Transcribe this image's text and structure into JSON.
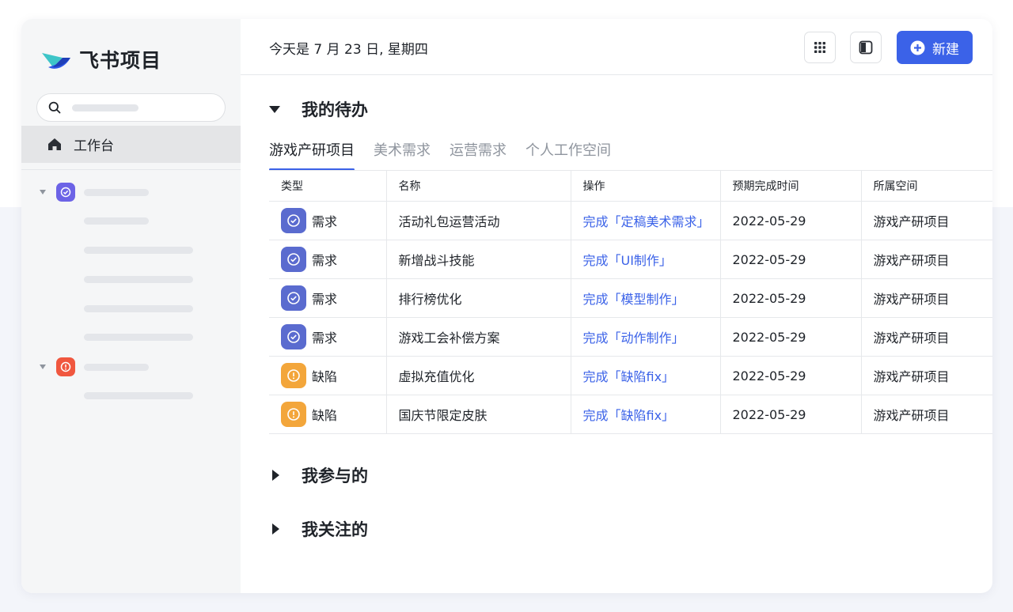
{
  "app": {
    "name": "飞书项目"
  },
  "header": {
    "date_text": "今天是 7 月 23 日, 星期四",
    "new_button_label": "新建"
  },
  "sidebar": {
    "active_item": {
      "label": "工作台",
      "icon": "home-icon"
    },
    "groups": [
      {
        "icon": "check-circle-icon",
        "color": "#6c63e6",
        "skeleton_item_count": 5
      },
      {
        "icon": "alert-circle-icon",
        "color": "#f0573f",
        "skeleton_item_count": 1
      }
    ]
  },
  "sections": {
    "todo": {
      "title": "我的待办",
      "expanded": true
    },
    "participated": {
      "title": "我参与的",
      "expanded": false
    },
    "following": {
      "title": "我关注的",
      "expanded": false
    }
  },
  "tabs": [
    {
      "label": "游戏产研项目",
      "active": true
    },
    {
      "label": "美术需求",
      "active": false
    },
    {
      "label": "运营需求",
      "active": false
    },
    {
      "label": "个人工作空间",
      "active": false
    }
  ],
  "table": {
    "columns": [
      "类型",
      "名称",
      "操作",
      "预期完成时间",
      "所属空间"
    ],
    "rows": [
      {
        "type": "需求",
        "name": "活动礼包运营活动",
        "action": "完成「定稿美术需求」",
        "due": "2022-05-29",
        "space": "游戏产研项目"
      },
      {
        "type": "需求",
        "name": "新增战斗技能",
        "action": "完成「UI制作」",
        "due": "2022-05-29",
        "space": "游戏产研项目"
      },
      {
        "type": "需求",
        "name": "排行榜优化",
        "action": "完成「模型制作」",
        "due": "2022-05-29",
        "space": "游戏产研项目"
      },
      {
        "type": "需求",
        "name": "游戏工会补偿方案",
        "action": "完成「动作制作」",
        "due": "2022-05-29",
        "space": "游戏产研项目"
      },
      {
        "type": "缺陷",
        "name": "虚拟充值优化",
        "action": "完成「缺陷fix」",
        "due": "2022-05-29",
        "space": "游戏产研项目"
      },
      {
        "type": "缺陷",
        "name": "国庆节限定皮肤",
        "action": "完成「缺陷fix」",
        "due": "2022-05-29",
        "space": "游戏产研项目"
      }
    ]
  },
  "colors": {
    "accent": "#3b62e8",
    "requirement": "#5a6bcf",
    "defect": "#f3a63b",
    "group_purple": "#6c63e6",
    "group_red": "#f0573f"
  }
}
